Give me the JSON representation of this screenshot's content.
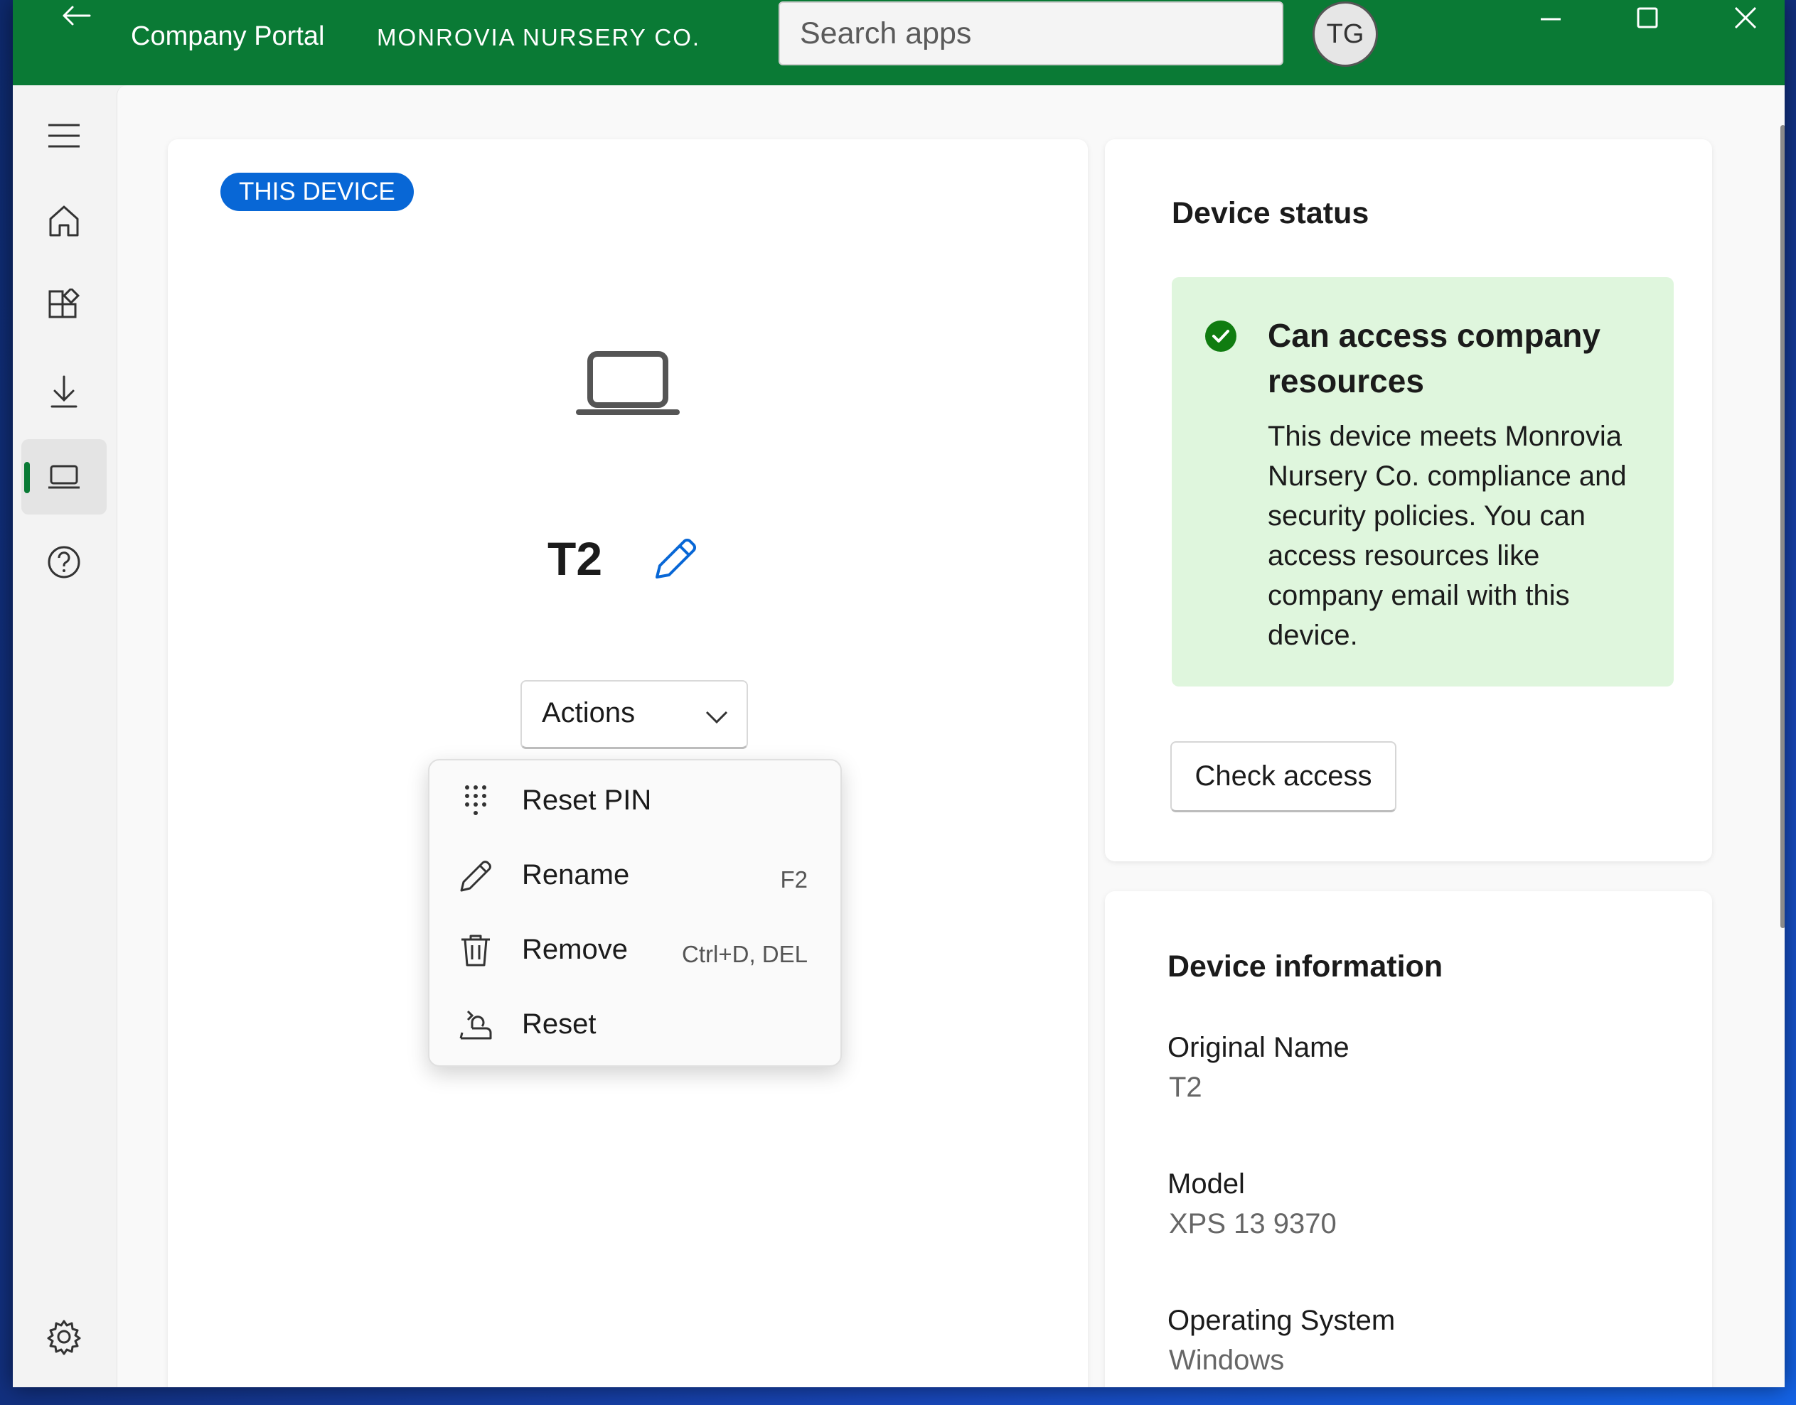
{
  "titlebar": {
    "app_title": "Company Portal",
    "org_name": "MONROVIA NURSERY CO.",
    "search_placeholder": "Search apps",
    "avatar_initials": "TG",
    "accent_color": "#0a7a35"
  },
  "nav": {
    "items": [
      "menu-icon",
      "home-icon",
      "apps-icon",
      "downloads-icon",
      "devices-icon",
      "help-icon",
      "settings-icon"
    ],
    "active": "devices-icon"
  },
  "device": {
    "badge": "THIS DEVICE",
    "name": "T2",
    "actions_label": "Actions",
    "menu": [
      {
        "label": "Reset PIN",
        "shortcut": "",
        "icon": "keypad-icon"
      },
      {
        "label": "Rename",
        "shortcut": "F2",
        "icon": "pencil-icon"
      },
      {
        "label": "Remove",
        "shortcut": "Ctrl+D, DEL",
        "icon": "trash-icon"
      },
      {
        "label": "Reset",
        "shortcut": "",
        "icon": "reset-icon"
      }
    ]
  },
  "status": {
    "heading": "Device status",
    "title": "Can access company resources",
    "description": "This device meets Monrovia Nursery Co. compliance and security policies. You can access resources like company email with this device.",
    "check_button": "Check access",
    "success_color": "#107c10"
  },
  "info": {
    "heading": "Device information",
    "fields": [
      {
        "label": "Original Name",
        "value": "T2"
      },
      {
        "label": "Model",
        "value": "XPS 13 9370"
      },
      {
        "label": "Operating System",
        "value": "Windows"
      }
    ]
  }
}
